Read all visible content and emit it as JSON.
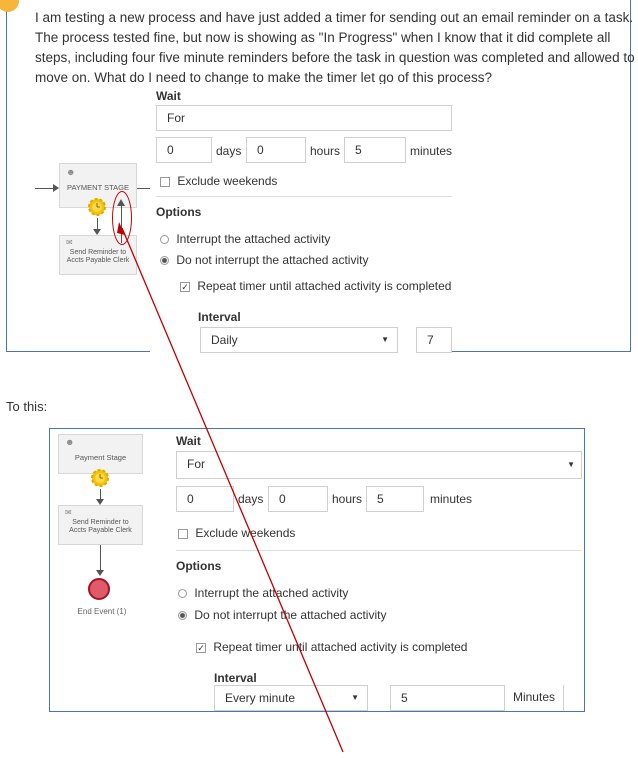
{
  "question": {
    "text": "I am testing a new process and have just added a timer for sending out an email reminder on a task. The process tested fine, but now is showing as \"In Progress\" when I know that it did complete all steps, including four five minute reminders before the task in question was completed and allowed to move on.  What do I need to change to make the timer let go of this process?"
  },
  "top_panel": {
    "wait_label": "Wait",
    "wait_value": "For",
    "days_value": "0",
    "days_label": "days",
    "hours_value": "0",
    "hours_label": "hours",
    "minutes_value": "5",
    "minutes_label": "minutes",
    "exclude_weekends": "Exclude weekends",
    "options_label": "Options",
    "option_interrupt": "Interrupt the attached activity",
    "option_no_interrupt": "Do not interrupt the attached activity",
    "repeat_label": "Repeat timer until attached activity is completed",
    "interval_label": "Interval",
    "interval_value": "Daily",
    "interval_number": "7",
    "diagram": {
      "stage_label": "PAYMENT STAGE",
      "task_label": "Send Reminder to Accts Payable Clerk"
    }
  },
  "caption": "To this:",
  "bottom_panel": {
    "wait_label": "Wait",
    "wait_value": "For",
    "days_value": "0",
    "days_label": "days",
    "hours_value": "0",
    "hours_label": "hours",
    "minutes_value": "5",
    "minutes_label": "minutes",
    "exclude_weekends": "Exclude weekends",
    "options_label": "Options",
    "option_interrupt": "Interrupt the attached activity",
    "option_no_interrupt": "Do not interrupt the attached activity",
    "repeat_label": "Repeat timer until attached activity is completed",
    "interval_label": "Interval",
    "interval_value": "Every minute",
    "interval_number": "5",
    "interval_unit": "Minutes",
    "diagram": {
      "stage_label": "Payment Stage",
      "task_label": "Send Reminder to Accts Payable Clerk",
      "end_label": "End Event (1)"
    }
  },
  "colors": {
    "frame_border": "#4a74b4",
    "annotation": "#c00000",
    "timer_gear": "#f5c400",
    "end_event": "#e05a6a"
  }
}
